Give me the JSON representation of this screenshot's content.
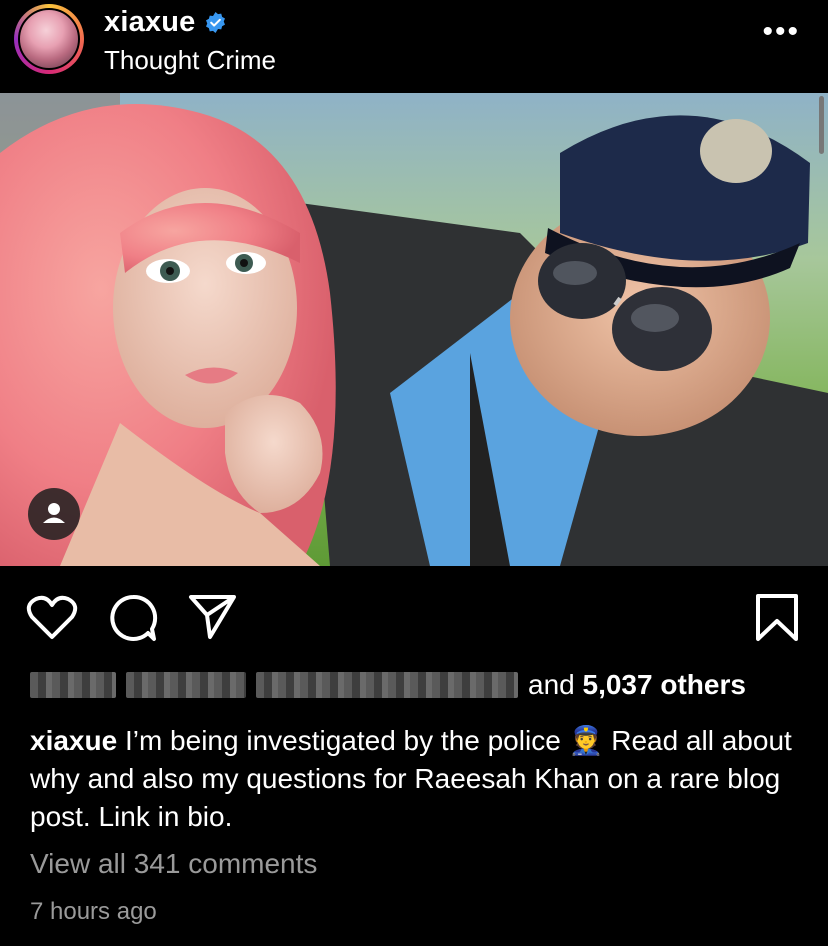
{
  "post": {
    "username": "xiaxue",
    "subtitle": "Thought Crime",
    "more": "•••"
  },
  "likes": {
    "suffix_and": "and",
    "count_text": "5,037 others"
  },
  "caption": {
    "user": "xiaxue",
    "text_before_emoji": "I’m being investigated by the police",
    "emoji": "👮",
    "text_after_emoji": "Read all about why and also my questions for Raeesah Khan on a rare blog post. Link in bio."
  },
  "comments": {
    "view_all": "View all 341 comments"
  },
  "timestamp": "7 hours ago",
  "colors": {
    "background": "#000000",
    "verified": "#3897f0",
    "muted_text": "#9a9a9a"
  },
  "icons": [
    "verified-badge-icon",
    "more-options-icon",
    "user-tag-icon",
    "like-heart-icon",
    "comment-icon",
    "share-icon",
    "save-bookmark-icon"
  ]
}
